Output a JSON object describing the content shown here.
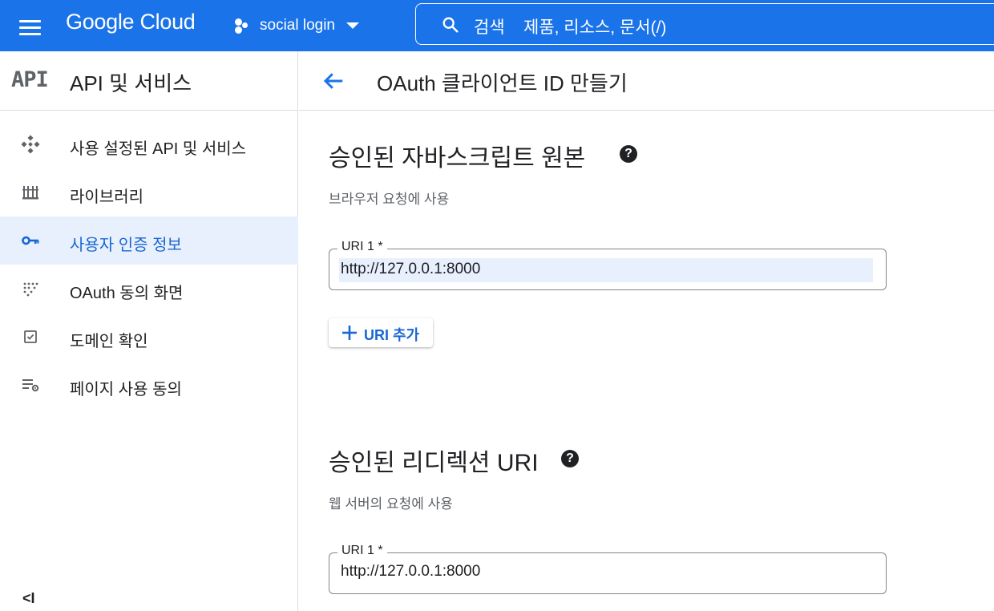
{
  "topbar": {
    "logo": "Google Cloud",
    "project_name": "social login",
    "search_label": "검색",
    "search_placeholder": "제품, 리소스, 문서(/)"
  },
  "sidebar": {
    "product_mono": "API",
    "title": "API 및 서비스",
    "items": [
      {
        "label": "사용 설정된 API 및 서비스",
        "icon": "api-diamond-icon",
        "active": false
      },
      {
        "label": "라이브러리",
        "icon": "library-icon",
        "active": false
      },
      {
        "label": "사용자 인증 정보",
        "icon": "key-icon",
        "active": true
      },
      {
        "label": "OAuth 동의 화면",
        "icon": "oauth-dots-icon",
        "active": false
      },
      {
        "label": "도메인 확인",
        "icon": "checkbox-icon",
        "active": false
      },
      {
        "label": "페이지 사용 동의",
        "icon": "settings-list-icon",
        "active": false
      }
    ],
    "collapse_glyph": "<I"
  },
  "main": {
    "page_title": "OAuth 클라이언트 ID 만들기",
    "js_origins": {
      "title": "승인된 자바스크립트 원본",
      "help": "?",
      "subtext": "브라우저 요청에 사용",
      "field_label": "URI 1 *",
      "field_value": "http://127.0.0.1:8000",
      "add_button": "URI 추가"
    },
    "redirect_uris": {
      "title": "승인된 리디렉션 URI",
      "help": "?",
      "subtext": "웹 서버의 요청에 사용",
      "field_label": "URI 1 *",
      "field_value": "http://127.0.0.1:8000"
    }
  },
  "colors": {
    "brand_blue": "#1a73e8",
    "active_blue": "#1967d2",
    "active_bg": "#e8f0fe"
  }
}
